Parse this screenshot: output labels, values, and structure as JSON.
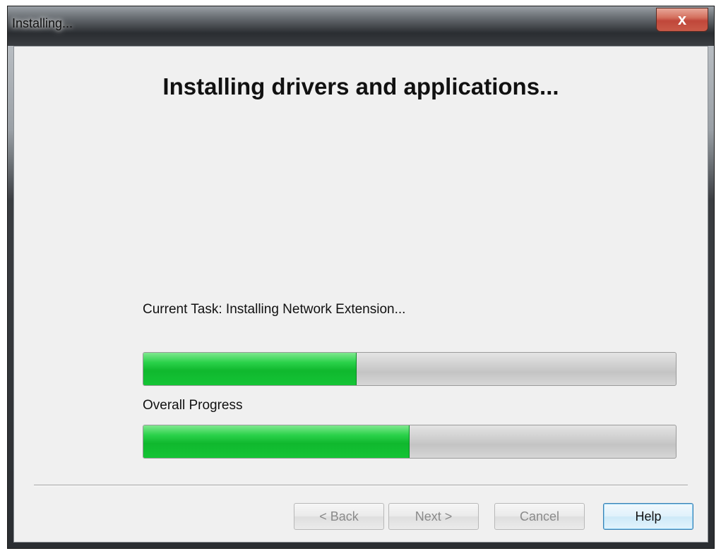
{
  "window": {
    "title": "Installing...",
    "close_glyph": "x"
  },
  "main": {
    "heading": "Installing drivers and applications...",
    "current_task_label": "Current Task: Installing Network Extension...",
    "current_task_progress": 0.4,
    "overall_label": "Overall Progress",
    "overall_progress": 0.5
  },
  "buttons": {
    "back": "< Back",
    "next": "Next >",
    "cancel": "Cancel",
    "help": "Help"
  },
  "colors": {
    "progress_fill": "#18c23a",
    "help_border": "#3c7fb1"
  }
}
